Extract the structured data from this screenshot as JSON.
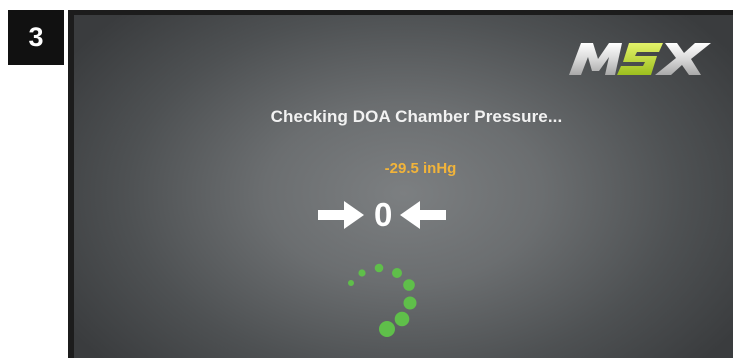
{
  "step": {
    "number": "3"
  },
  "brand": {
    "logo_text": "MSX"
  },
  "status": {
    "message": "Checking DOA Chamber Pressure..."
  },
  "pressure": {
    "reading": "-29.5 inHg",
    "indicator_value": "0"
  },
  "colors": {
    "reading": "#f2b43a",
    "spinner": "#5fbf4a",
    "text": "#f2f2f2"
  },
  "icons": {
    "left_arrow": "arrow-right-icon",
    "right_arrow": "arrow-left-icon",
    "spinner": "loading-spinner-icon"
  }
}
